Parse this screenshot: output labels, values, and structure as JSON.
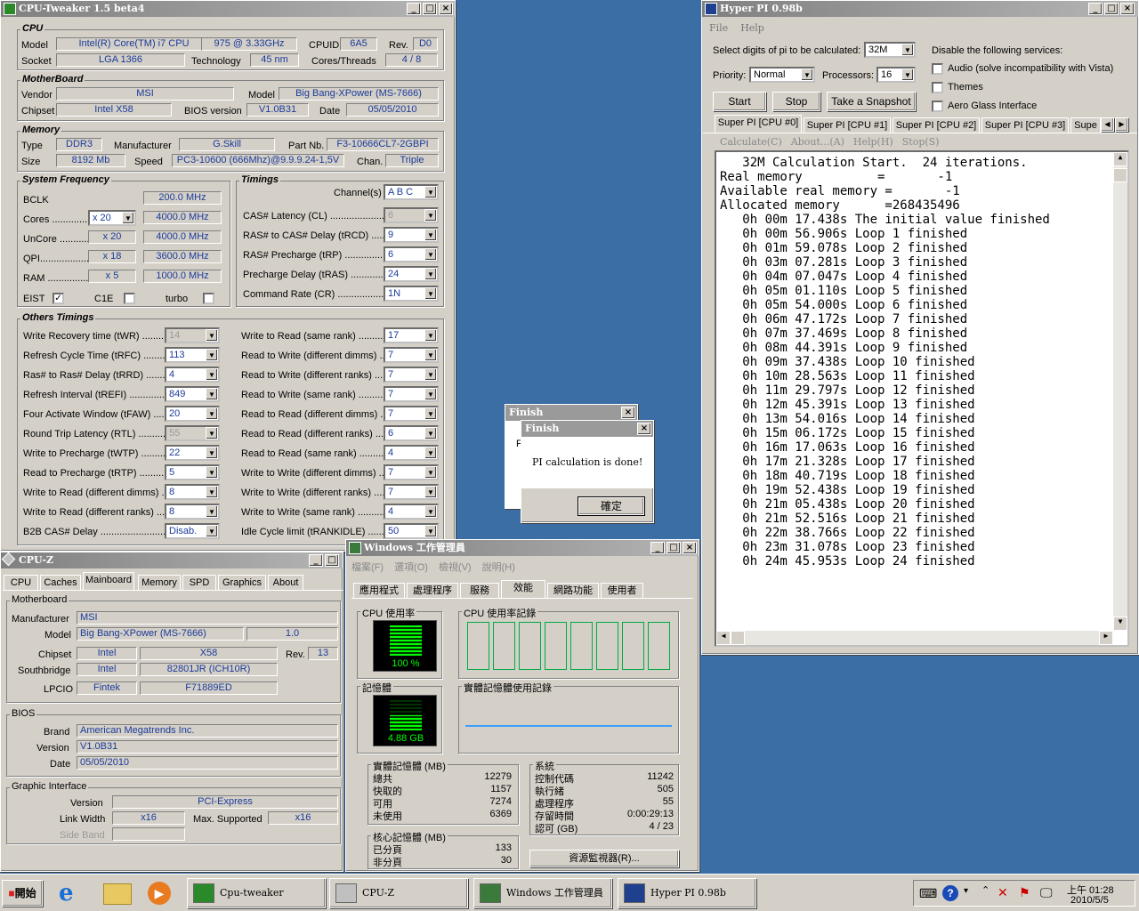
{
  "ct": {
    "title": "CPU-Tweaker 1.5 beta4",
    "cpu": {
      "g": "CPU",
      "model_l": "Model",
      "model": "Intel(R) Core(TM) i7 CPU",
      "model2": "975  @ 3.33GHz",
      "cpuid_l": "CPUID",
      "cpuid": "6A5",
      "rev_l": "Rev.",
      "rev": "D0",
      "socket_l": "Socket",
      "socket": "LGA 1366",
      "tech_l": "Technology",
      "tech": "45 nm",
      "ct_l": "Cores/Threads",
      "ct": "4 / 8"
    },
    "mb": {
      "g": "MotherBoard",
      "vendor_l": "Vendor",
      "vendor": "MSI",
      "model_l": "Model",
      "model": "Big Bang-XPower (MS-7666)",
      "chipset_l": "Chipset",
      "chipset": "Intel X58",
      "bios_l": "BIOS version",
      "bios": "V1.0B31",
      "date_l": "Date",
      "date": "05/05/2010"
    },
    "mem": {
      "g": "Memory",
      "type_l": "Type",
      "type": "DDR3",
      "man_l": "Manufacturer",
      "man": "G.Skill",
      "part_l": "Part Nb.",
      "part": "F3-10666CL7-2GBPI",
      "size_l": "Size",
      "size": "8192 Mb",
      "speed_l": "Speed",
      "speed": "PC3-10600 (666Mhz)@9.9.9.24-1,5V",
      "chan_l": "Chan.",
      "chan": "Triple"
    },
    "sf": {
      "g": "System Frequency",
      "bclk_l": "BCLK",
      "bclk": "200.0 MHz",
      "cores_l": "Cores ..............",
      "cores_m": "x 20",
      "cores": "4000.0 MHz",
      "uncore_l": "UnCore ............",
      "uncore_m": "x 20",
      "uncore": "4000.0 MHz",
      "qpi_l": "QPI...................",
      "qpi_m": "x 18",
      "qpi": "3600.0 MHz",
      "ram_l": "RAM ..................",
      "ram_m": "x 5",
      "ram": "1000.0 MHz",
      "eist": "EIST",
      "c1e": "C1E",
      "turbo": "turbo",
      "check": "✓"
    },
    "tim": {
      "g": "Timings",
      "chan_l": "Channel(s)",
      "chan": "A B C",
      "rows": [
        {
          "l": "CAS# Latency (CL) ..........................",
          "v": "6"
        },
        {
          "l": "RAS# to CAS# Delay (tRCD) .......",
          "v": "9"
        },
        {
          "l": "RAS# Precharge (tRP) ...................",
          "v": "6"
        },
        {
          "l": "Precharge Delay (tRAS) ...............",
          "v": "24"
        },
        {
          "l": "Command Rate (CR) .....................",
          "v": "1N"
        }
      ]
    },
    "ot": {
      "g": "Others Timings",
      "left": [
        {
          "l": "Write Recovery time (tWR) ........",
          "v": "14"
        },
        {
          "l": "Refresh Cycle Time (tRFC) ........",
          "v": "113"
        },
        {
          "l": "Ras# to Ras# Delay (tRRD) ........",
          "v": "4"
        },
        {
          "l": "Refresh Interval (tREFI) ..............",
          "v": "849"
        },
        {
          "l": "Four Activate Window (tFAW) .....",
          "v": "20"
        },
        {
          "l": "Round Trip Latency (RTL) ...........",
          "v": "55"
        },
        {
          "l": "Write to Precharge (tWTP) ...........",
          "v": "22"
        },
        {
          "l": "Read to Precharge (tRTP) ............",
          "v": "5"
        },
        {
          "l": "Write to Read (different dimms) ..",
          "v": "8"
        },
        {
          "l": "Write to Read (different ranks) ...",
          "v": "8"
        },
        {
          "l": "B2B CAS# Delay ...........................",
          "v": "Disab."
        }
      ],
      "right": [
        {
          "l": "Write to Read (same rank) ...........",
          "v": "17"
        },
        {
          "l": "Read to Write (different dimms) ....",
          "v": "7"
        },
        {
          "l": "Read to Write (different ranks) ....",
          "v": "7"
        },
        {
          "l": "Read to Write (same rank) .............",
          "v": "7"
        },
        {
          "l": "Read to Read (different dimms) .....",
          "v": "7"
        },
        {
          "l": "Read to Read (different ranks) ......",
          "v": "6"
        },
        {
          "l": "Read to Read (same rank) ..............",
          "v": "4"
        },
        {
          "l": "Write to Write (different dimms) ....",
          "v": "7"
        },
        {
          "l": "Write to Write (different ranks) .....",
          "v": "7"
        },
        {
          "l": "Write to Write (same rank) ...........",
          "v": "4"
        },
        {
          "l": "Idle Cycle limit (tRANKIDLE) .........",
          "v": "50"
        }
      ]
    }
  },
  "cz": {
    "title": "CPU-Z",
    "tabs": [
      "CPU",
      "Caches",
      "Mainboard",
      "Memory",
      "SPD",
      "Graphics",
      "About"
    ],
    "mb": {
      "g": "Motherboard",
      "man_l": "Manufacturer",
      "man": "MSI",
      "model_l": "Model",
      "model": "Big Bang-XPower (MS-7666)",
      "model_v": "1.0",
      "chip_l": "Chipset",
      "chip": "Intel",
      "chip2": "X58",
      "rev_l": "Rev.",
      "rev": "13",
      "sb_l": "Southbridge",
      "sb": "Intel",
      "sb2": "82801JR (ICH10R)",
      "lpc_l": "LPCIO",
      "lpc": "Fintek",
      "lpc2": "F71889ED"
    },
    "bios": {
      "g": "BIOS",
      "brand_l": "Brand",
      "brand": "American Megatrends Inc.",
      "ver_l": "Version",
      "ver": "V1.0B31",
      "date_l": "Date",
      "date": "05/05/2010"
    },
    "gi": {
      "g": "Graphic Interface",
      "ver_l": "Version",
      "ver": "PCI-Express",
      "lw_l": "Link Width",
      "lw": "x16",
      "ms_l": "Max. Supported",
      "ms": "x16",
      "sb_l": "Side Band"
    }
  },
  "tm": {
    "title": "Windows 工作管理員",
    "menu": [
      "檔案(F)",
      "選項(O)",
      "檢視(V)",
      "說明(H)"
    ],
    "tabs": [
      "應用程式",
      "處理程序",
      "服務",
      "效能",
      "網路功能",
      "使用者"
    ],
    "cpu_l": "CPU 使用率",
    "cpu": "100 %",
    "cpuh_l": "CPU 使用率記錄",
    "mem_l": "記憶體",
    "mem": "4.88 GB",
    "memh_l": "實體記憶體使用記錄",
    "phys": {
      "g": "實體記憶體 (MB)",
      "rows": [
        {
          "l": "總共",
          "v": "12279"
        },
        {
          "l": "快取的",
          "v": "1157"
        },
        {
          "l": "可用",
          "v": "7274"
        },
        {
          "l": "未使用",
          "v": "6369"
        }
      ]
    },
    "sys": {
      "g": "系統",
      "rows": [
        {
          "l": "控制代碼",
          "v": "11242"
        },
        {
          "l": "執行緒",
          "v": "505"
        },
        {
          "l": "處理程序",
          "v": "55"
        },
        {
          "l": "存留時間",
          "v": "0:00:29:13"
        },
        {
          "l": "認可 (GB)",
          "v": "4 / 23"
        }
      ]
    },
    "kern": {
      "g": "核心記憶體 (MB)",
      "rows": [
        {
          "l": "已分頁",
          "v": "133"
        },
        {
          "l": "非分頁",
          "v": "30"
        }
      ]
    },
    "rm": "資源監視器(R)..."
  },
  "hp": {
    "title": "Hyper PI 0.98b",
    "menu": [
      "File",
      "Help"
    ],
    "digits_l": "Select digits of pi to be calculated:",
    "digits": "32M",
    "prio_l": "Priority:",
    "prio": "Normal",
    "proc_l": "Processors:",
    "proc": "16",
    "dis_l": "Disable the following services:",
    "svc": [
      "Audio (solve incompatibility with Vista)",
      "Themes",
      "Aero Glass Interface"
    ],
    "btns": [
      "Start",
      "Stop",
      "Take a Snapshot"
    ],
    "tabs": [
      "Super PI [CPU #0]",
      "Super PI [CPU #1]",
      "Super PI [CPU #2]",
      "Super PI [CPU #3]",
      "Supe"
    ],
    "sub": [
      "Calculate(C)",
      "About...(A)",
      "Help(H)",
      "Stop(S)"
    ],
    "log": [
      "   32M Calculation Start.  24 iterations.",
      "Real memory          =       -1",
      "Available real memory =       -1",
      "Allocated memory      =268435496",
      "   0h 00m 17.438s The initial value finished",
      "   0h 00m 56.906s Loop 1 finished",
      "   0h 01m 59.078s Loop 2 finished",
      "   0h 03m 07.281s Loop 3 finished",
      "   0h 04m 07.047s Loop 4 finished",
      "   0h 05m 01.110s Loop 5 finished",
      "   0h 05m 54.000s Loop 6 finished",
      "   0h 06m 47.172s Loop 7 finished",
      "   0h 07m 37.469s Loop 8 finished",
      "   0h 08m 44.391s Loop 9 finished",
      "   0h 09m 37.438s Loop 10 finished",
      "   0h 10m 28.563s Loop 11 finished",
      "   0h 11m 29.797s Loop 12 finished",
      "   0h 12m 45.391s Loop 13 finished",
      "   0h 13m 54.016s Loop 14 finished",
      "   0h 15m 06.172s Loop 15 finished",
      "   0h 16m 17.063s Loop 16 finished",
      "   0h 17m 21.328s Loop 17 finished",
      "   0h 18m 40.719s Loop 18 finished",
      "   0h 19m 52.438s Loop 19 finished",
      "   0h 21m 05.438s Loop 20 finished",
      "   0h 21m 52.516s Loop 21 finished",
      "   0h 22m 38.766s Loop 22 finished",
      "   0h 23m 31.078s Loop 23 finished",
      "   0h 24m 45.953s Loop 24 finished"
    ]
  },
  "fin": {
    "title": "Finish",
    "msg": "PI calculation is done!",
    "ok": "確定",
    "behind": "F"
  },
  "task": {
    "start": "開始",
    "items": [
      "Cpu-tweaker",
      "CPU-Z",
      "Windows 工作管理員",
      "Hyper PI 0.98b"
    ],
    "time": "上午 01:28",
    "date": "2010/5/5"
  }
}
